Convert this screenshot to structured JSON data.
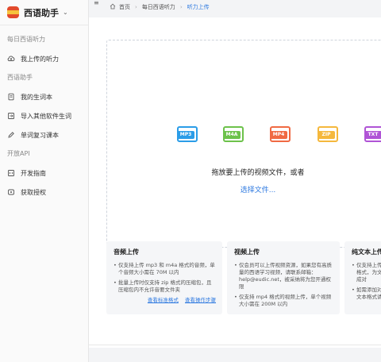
{
  "brand": {
    "name": "西语助手",
    "caret": "⌄"
  },
  "sidebar": {
    "sections": [
      {
        "title": "每日西语听力",
        "items": [
          {
            "label": "我上传的听力",
            "icon": "cloud-upload-icon"
          }
        ]
      },
      {
        "title": "西语助手",
        "items": [
          {
            "label": "我的生词本",
            "icon": "notebook-icon"
          },
          {
            "label": "导入其他软件生词",
            "icon": "import-icon"
          },
          {
            "label": "单词复习课本",
            "icon": "pen-icon"
          }
        ]
      },
      {
        "title": "开放API",
        "items": [
          {
            "label": "开发指南",
            "icon": "code-icon"
          },
          {
            "label": "获取授权",
            "icon": "key-icon"
          }
        ]
      }
    ]
  },
  "breadcrumb": {
    "home": "首页",
    "parent": "每日西语听力",
    "current": "听力上传"
  },
  "upload": {
    "chips": [
      {
        "label": "MP3",
        "color": "#2b9de8"
      },
      {
        "label": "M4A",
        "color": "#6dc24b"
      },
      {
        "label": "MP4",
        "color": "#f06a43"
      },
      {
        "label": "ZIP",
        "color": "#f5b83d"
      },
      {
        "label": "TXT",
        "color": "#b054d6"
      }
    ],
    "prompt": "拖放要上传的视频文件，或者",
    "select_label": "选择文件..."
  },
  "cards": [
    {
      "title": "音频上传",
      "items": [
        "仅支持上传 mp3 和 m4a 格式的音频，单个音频大小需在 70M 以内",
        "批量上传时仅支持 zip 格式的压缩包，且压缩包内不允许音要文件夹"
      ],
      "links": [
        "查看标准格式",
        "查看操作步骤"
      ]
    },
    {
      "title": "视频上传",
      "items": [
        "仅会员可以上传视频资源，如果您有高质量的西语学习视频，请联系邮箱：help@eudic.net，被采纳将为您开通权限",
        "仅支持 mp4 格式的视频上传，单个视频大小需在 200M 以内"
      ],
      "links": []
    },
    {
      "title": "纯文本上传",
      "items": [
        "仅支持上传 txt 格式，为文本生成对",
        "如需添加对照，文本格式请参考"
      ],
      "links": []
    }
  ]
}
